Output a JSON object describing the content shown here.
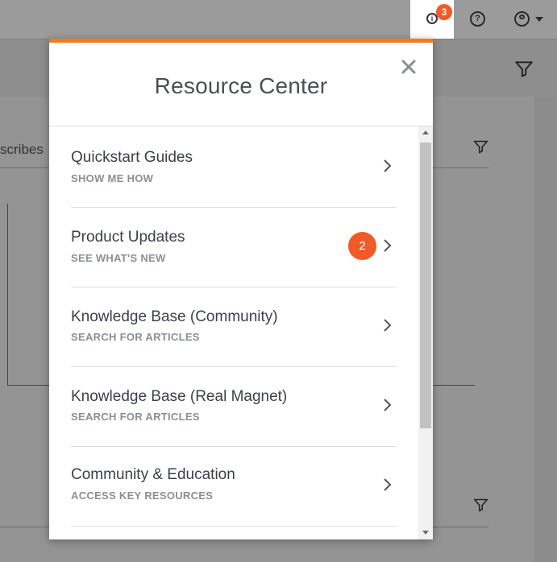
{
  "header": {
    "info_badge_count": "3",
    "icons": [
      "info-icon",
      "help-icon",
      "user-icon",
      "chevron-down-icon"
    ]
  },
  "background": {
    "partial_text": "scribes"
  },
  "resource_center": {
    "title": "Resource Center",
    "close_icon": "close-icon",
    "accent_color": "#f47b20",
    "badge_color": "#f05a28",
    "items": [
      {
        "title": "Quickstart Guides",
        "subtitle": "SHOW ME HOW"
      },
      {
        "title": "Product Updates",
        "subtitle": "SEE WHAT'S NEW",
        "badge": "2"
      },
      {
        "title": "Knowledge Base (Community)",
        "subtitle": "SEARCH FOR ARTICLES"
      },
      {
        "title": "Knowledge Base (Real Magnet)",
        "subtitle": "SEARCH FOR ARTICLES"
      },
      {
        "title": "Community & Education",
        "subtitle": "ACCESS KEY RESOURCES"
      }
    ]
  }
}
